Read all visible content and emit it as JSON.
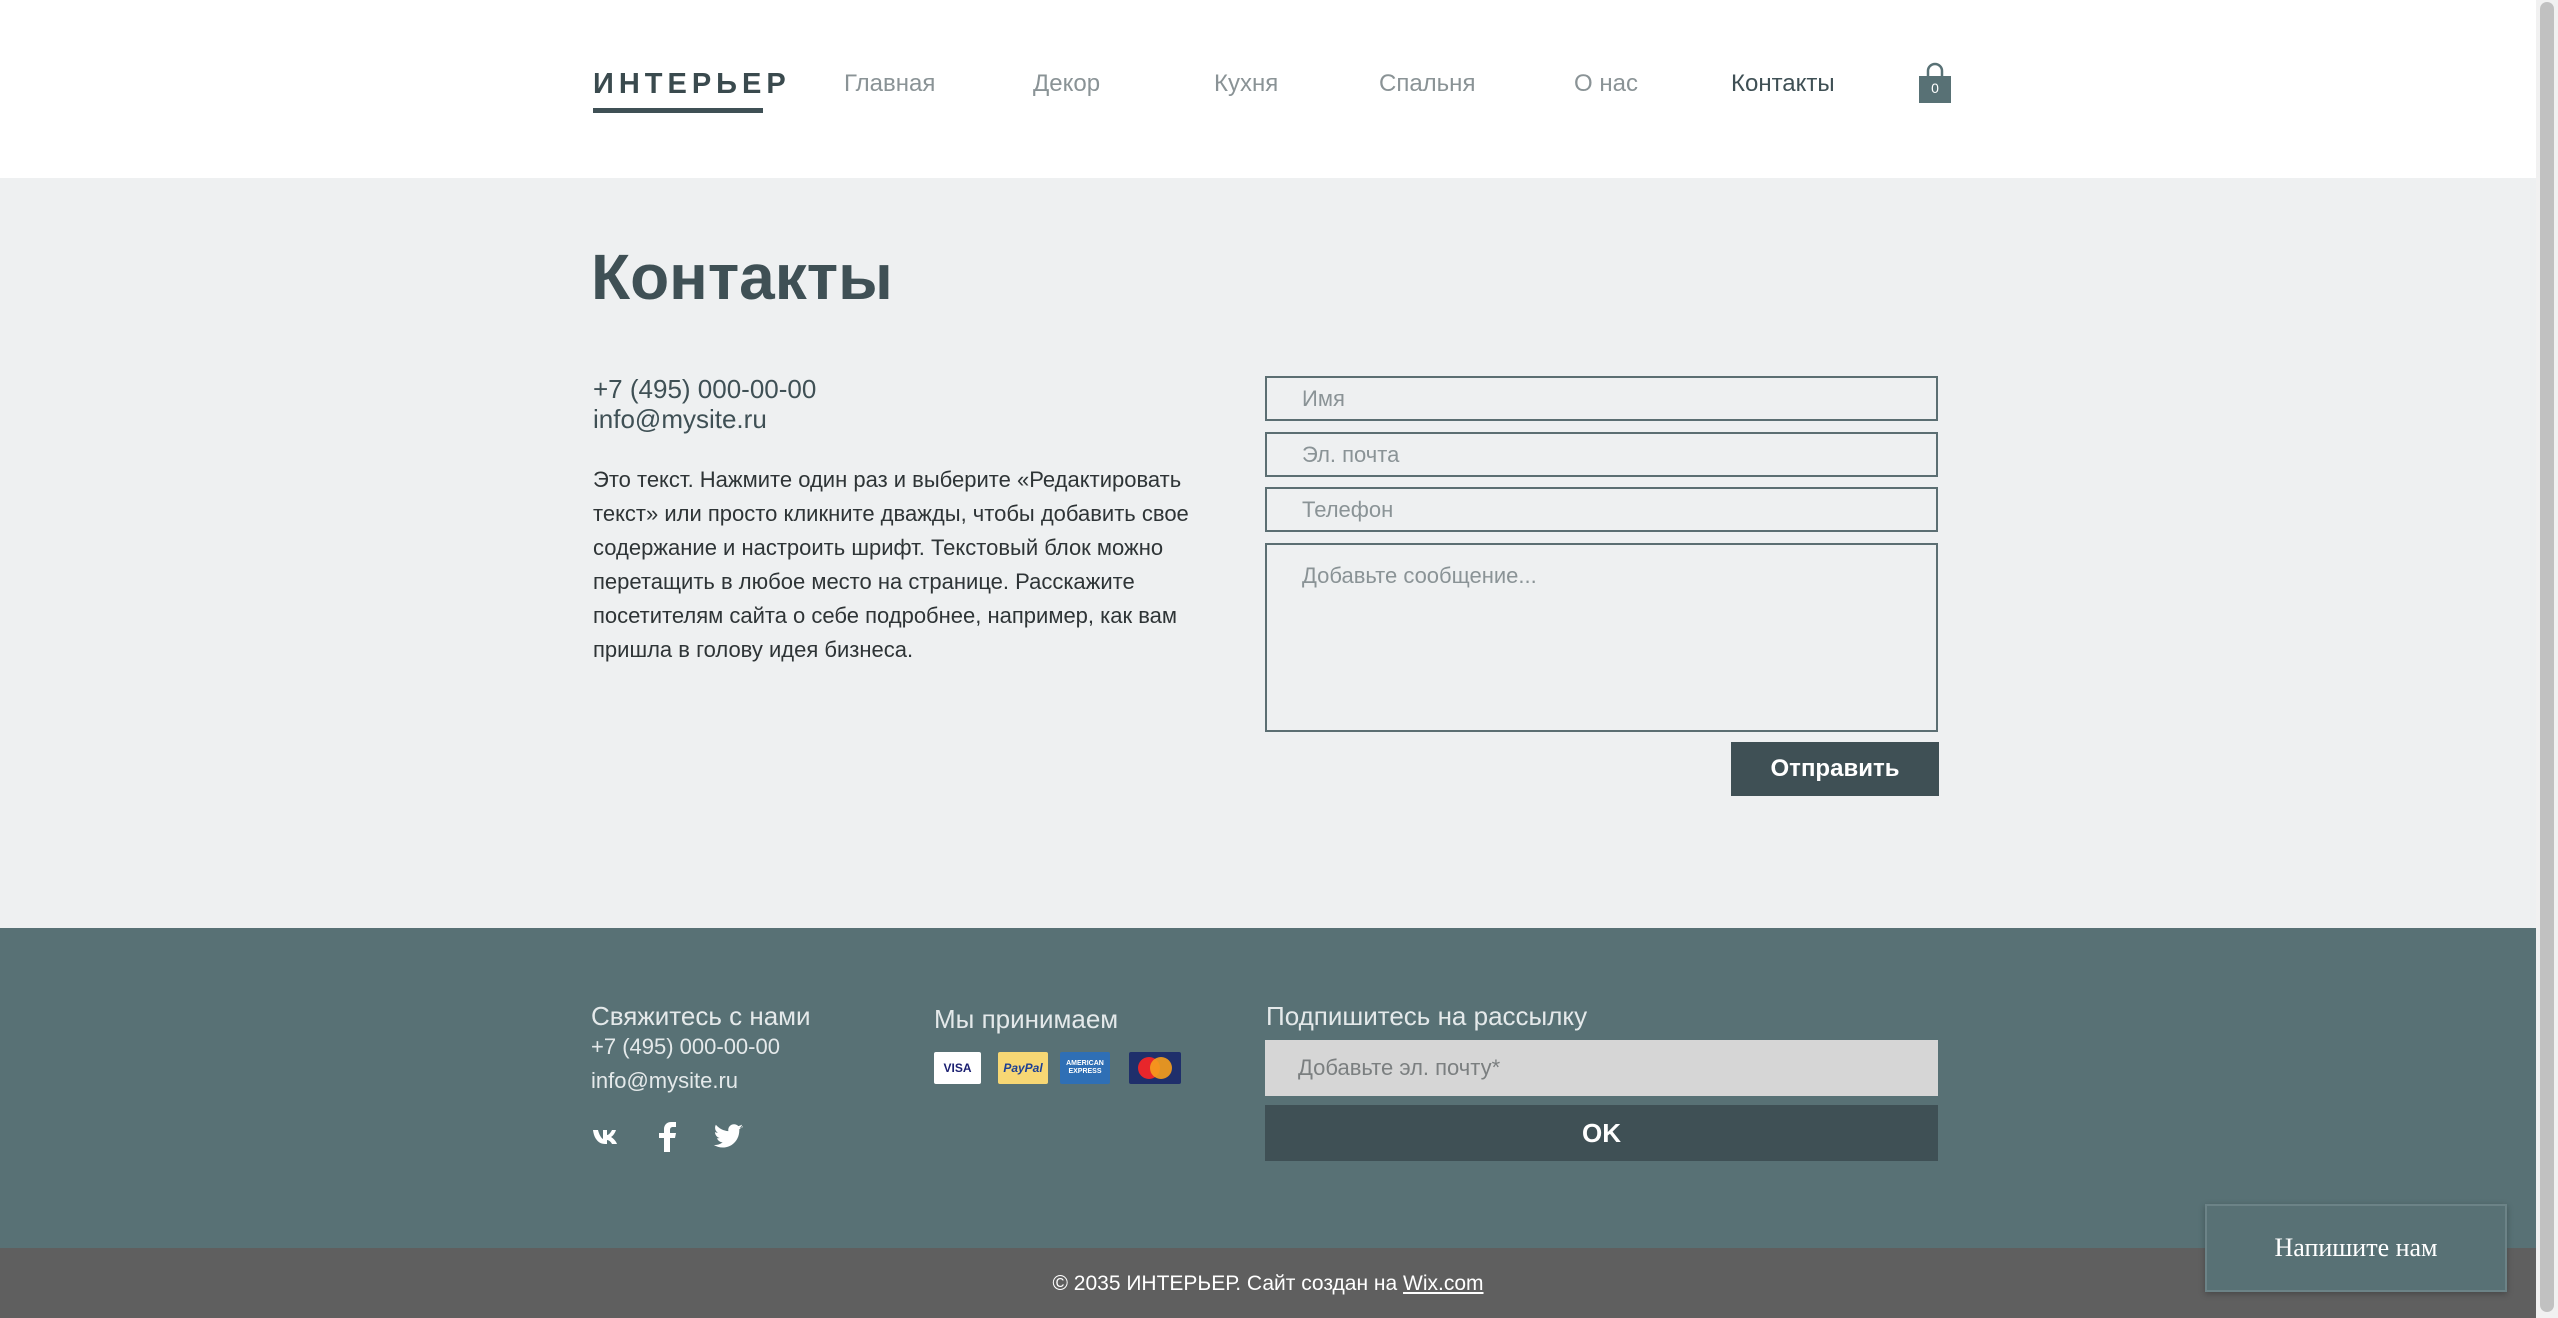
{
  "header": {
    "logo": "ИНТЕРЬЕР",
    "nav": [
      {
        "label": "Главная"
      },
      {
        "label": "Декор"
      },
      {
        "label": "Кухня"
      },
      {
        "label": "Спальня"
      },
      {
        "label": "О нас"
      },
      {
        "label": "Контакты",
        "active": true
      }
    ],
    "cart_count": "0",
    "cart_icon": "shopping-bag-icon"
  },
  "main": {
    "title": "Контакты",
    "phone": "+7 (495) 000-00-00",
    "email": "info@mysite.ru",
    "about": "Это текст. Нажмите один раз и выберите «Редактировать текст» или просто кликните дважды, чтобы добавить свое содержание и настроить шрифт. Текстовый блок можно перетащить в любое место на странице. Расскажите посетителям сайта о себе подробнее, например, как вам пришла в голову идея бизнеса.",
    "form": {
      "name_placeholder": "Имя",
      "email_placeholder": "Эл. почта",
      "phone_placeholder": "Телефон",
      "message_placeholder": "Добавьте сообщение...",
      "submit_label": "Отправить"
    }
  },
  "footer": {
    "contact_heading": "Свяжитесь с нами",
    "phone": "+7 (495) 000-00-00",
    "email": "info@mysite.ru",
    "social": [
      "vk-icon",
      "facebook-icon",
      "twitter-icon"
    ],
    "payments_heading": "Мы принимаем",
    "payments": {
      "visa": "VISA",
      "paypal": "PayPal",
      "amex": "AMERICAN EXPRESS",
      "mastercard": "MasterCard"
    },
    "newsletter_heading": "Подпишитесь на рассылку",
    "newsletter_placeholder": "Добавьте эл. почту*",
    "newsletter_button": "OK",
    "copyright_prefix": "© 2035 ИНТЕРЬЕР. Сайт создан на ",
    "copyright_link": "Wix.com"
  },
  "chat": {
    "label": "Напишите нам"
  },
  "colors": {
    "accent": "#3f5055",
    "footer_bg": "#587175",
    "page_bg": "#eef0f1",
    "bottom_bar": "#5f5f5f"
  }
}
